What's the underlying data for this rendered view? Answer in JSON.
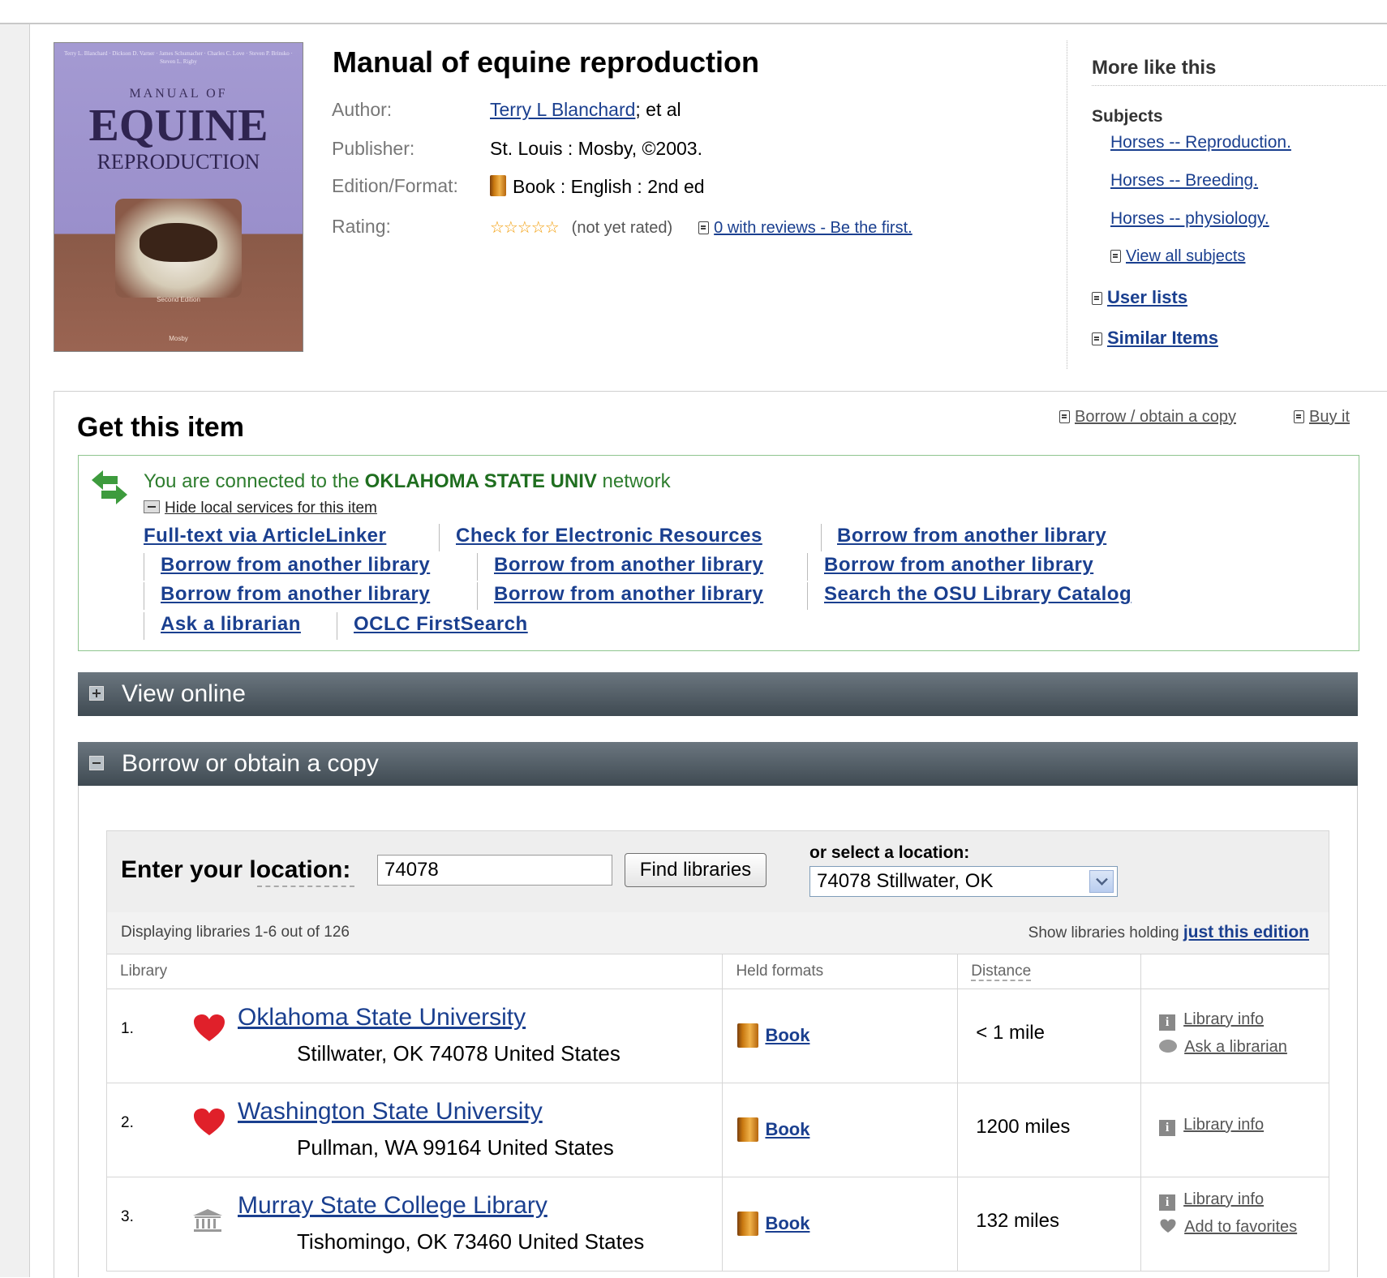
{
  "cover": {
    "authors": "Terry L. Blanchard · Dickson D. Varner · James Schumacher · Charles C. Love · Steven P. Brinsko · Steven L. Rigby",
    "line1": "MANUAL OF",
    "line2": "EQUINE",
    "line3": "REPRODUCTION",
    "edition": "Second Edition",
    "publisher": "Mosby"
  },
  "item": {
    "title": "Manual of equine reproduction",
    "author_label": "Author:",
    "author_link": "Terry L Blanchard",
    "author_suffix": "; et al",
    "publisher_label": "Publisher:",
    "publisher": "St. Louis : Mosby, ©2003.",
    "edition_label": "Edition/Format:",
    "edition": "Book : English : 2nd ed",
    "rating_label": "Rating:",
    "stars": "☆☆☆☆☆",
    "rating_text": "(not yet rated)",
    "reviews_link": "0 with reviews - Be the first."
  },
  "sidebar": {
    "title": "More like this",
    "subjects_label": "Subjects",
    "subjects": [
      "Horses -- Reproduction.",
      "Horses -- Breeding.",
      "Horses -- physiology."
    ],
    "view_all": "View all subjects",
    "user_lists": "User lists",
    "similar_items": "Similar Items"
  },
  "get": {
    "title": "Get this item",
    "borrow_link": "Borrow / obtain a copy",
    "buy_link": "Buy it",
    "connected_pre": "You are connected to the ",
    "network": "OKLAHOMA STATE UNIV",
    "connected_post": " network",
    "hide_local": "Hide local services for this item",
    "links": [
      "Full-text via ArticleLinker",
      "Check for Electronic Resources",
      "Borrow from another library",
      "Borrow from another library",
      "Borrow from another library",
      "Borrow from another library",
      "Borrow from another library",
      "Borrow from another library",
      "Search the OSU Library Catalog",
      "Ask a librarian",
      "OCLC FirstSearch"
    ]
  },
  "sections": {
    "view_online": "View online",
    "borrow": "Borrow or obtain a copy"
  },
  "location": {
    "label": "Enter your location:",
    "value": "74078",
    "button": "Find libraries",
    "or_select": "or select a location:",
    "selected": "74078 Stillwater, OK"
  },
  "listing": {
    "displaying": "Displaying libraries 1-6 out of 126",
    "show_prefix": "Show libraries holding ",
    "show_link": "just this edition",
    "columns": [
      "Library",
      "Held formats",
      "Distance",
      ""
    ],
    "rows": [
      {
        "num": "1.",
        "name": "Oklahoma State University",
        "address": "Stillwater, OK 74078 United States",
        "format": "Book",
        "distance": "< 1 mile",
        "action1": "Library info",
        "action2": "Ask a librarian",
        "icon": "heart-icon"
      },
      {
        "num": "2.",
        "name": "Washington State University",
        "address": "Pullman, WA 99164 United States",
        "format": "Book",
        "distance": "1200 miles",
        "action1": "Library info",
        "action2": "",
        "icon": "heart-icon"
      },
      {
        "num": "3.",
        "name": "Murray State College Library",
        "address": "Tishomingo, OK 73460 United States",
        "format": "Book",
        "distance": "132 miles",
        "action1": "Library info",
        "action2": "Add to favorites",
        "icon": "institution-icon"
      }
    ]
  },
  "colors": {
    "link": "#1a3f8f",
    "network_green": "#2e7d2e",
    "bar_dark": "#4a555d",
    "heart_red": "#e0202a"
  }
}
